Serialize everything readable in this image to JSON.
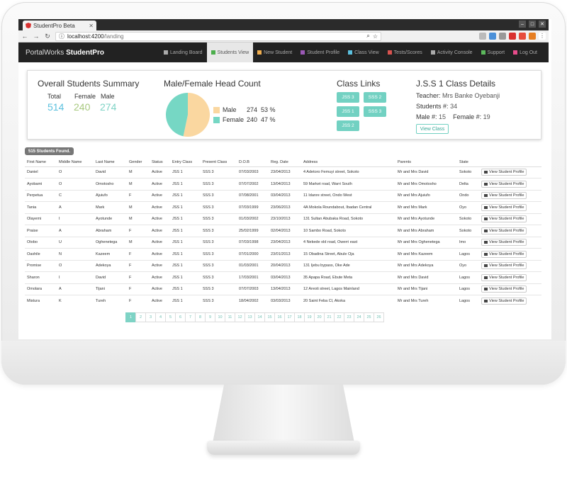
{
  "browser": {
    "tab_title": "StudentPro Beta",
    "url_host": "localhost:4200",
    "url_path": "/landing"
  },
  "navbar": {
    "brand_prefix": "PortalWorks",
    "brand_name": "StudentPro",
    "items": [
      {
        "label": "Landing Board",
        "icon": "home-icon",
        "color": "#aaaaaa"
      },
      {
        "label": "Students View",
        "icon": "eye-icon",
        "color": "#4cae4c"
      },
      {
        "label": "New Student",
        "icon": "user-icon",
        "color": "#f0ad4e"
      },
      {
        "label": "Student Profile",
        "icon": "profile-icon",
        "color": "#9b59b6"
      },
      {
        "label": "Class View",
        "icon": "users-icon",
        "color": "#5bc0de"
      },
      {
        "label": "Tests/Scores",
        "icon": "chart-icon",
        "color": "#d9534f"
      },
      {
        "label": "Activity Console",
        "icon": "image-icon",
        "color": "#aaaaaa"
      },
      {
        "label": "Support",
        "icon": "support-icon",
        "color": "#5cb85c"
      },
      {
        "label": "Log Out",
        "icon": "logout-icon",
        "color": "#e74c8b"
      }
    ]
  },
  "summary": {
    "title": "Overall Students Summary",
    "total_label": "Total",
    "female_label": "Female",
    "male_label": "Male",
    "total": "514",
    "female": "240",
    "male": "274"
  },
  "headcount": {
    "title": "Male/Female Head Count",
    "legend": [
      {
        "name": "Male",
        "count": "274",
        "pct": "53 %",
        "color": "#fad7a0"
      },
      {
        "name": "Female",
        "count": "240",
        "pct": "47 %",
        "color": "#76d7c4"
      }
    ]
  },
  "class_links": {
    "title": "Class Links",
    "items": [
      "JSS 3",
      "SSS 2",
      "JSS 1",
      "SSS 3",
      "JSS 2"
    ]
  },
  "class_details": {
    "title": "J.S.S 1 Class Details",
    "teacher_label": "Teacher:",
    "teacher": "Mrs Banke Oyebanji",
    "students_label": "Students #:",
    "students": "34",
    "male_label": "Male #:",
    "male": "15",
    "female_label": "Female #:",
    "female": "19",
    "button": "View Class"
  },
  "found_badge": "515 Students Found.",
  "table": {
    "headers": [
      "First Name",
      "Middle Name",
      "Last Name",
      "Gender",
      "Status",
      "Entry Class",
      "Present Class",
      "D.O.B",
      "Reg. Date",
      "Address",
      "Parents",
      "State",
      ""
    ],
    "action_label": "View Student Profile",
    "rows": [
      [
        "Daniel",
        "O",
        "David",
        "M",
        "Active",
        "JSS 1",
        "SSS 3",
        "07/03/2003",
        "23/04/2013",
        "4 Adetoro Femuyi street, Sokoto",
        "Mr and Mrs David",
        "Sokoto"
      ],
      [
        "Ayobami",
        "O",
        "Omotosho",
        "M",
        "Active",
        "JSS 1",
        "SSS 3",
        "07/07/2002",
        "13/04/2013",
        "59 Market road, Warri South",
        "Mr and Mrs Omotosho",
        "Delta"
      ],
      [
        "Perpetua",
        "C",
        "Ajuiufo",
        "F",
        "Active",
        "JSS 1",
        "SSS 3",
        "07/08/2001",
        "03/04/2013",
        "11 Idanre street, Ondo West",
        "Mr and Mrs Ajuiufo",
        "Ondo"
      ],
      [
        "Tania",
        "A",
        "Mark",
        "M",
        "Active",
        "JSS 1",
        "SSS 3",
        "07/03/1999",
        "23/06/2013",
        "4A Mokola Roundabout, Ibadan Central",
        "Mr and Mrs Mark",
        "Oyo"
      ],
      [
        "Olayemi",
        "I",
        "Ayotunde",
        "M",
        "Active",
        "JSS 1",
        "SSS 3",
        "01/03/2002",
        "23/10/2013",
        "131 Sultan Abubaka Road, Sokoto",
        "Mr and Mrs Ayotunde",
        "Sokoto"
      ],
      [
        "Praise",
        "A",
        "Abraham",
        "F",
        "Active",
        "JSS 1",
        "SSS 3",
        "25/02/1999",
        "02/04/2013",
        "10 Sambo Road, Sokoto",
        "Mr and Mrs Abraham",
        "Sokoto"
      ],
      [
        "Otobo",
        "U",
        "Oghenetega",
        "M",
        "Active",
        "JSS 1",
        "SSS 3",
        "07/03/1998",
        "23/04/2013",
        "4 Nekede old road, Owerri east",
        "Mr and Mrs Oghenetega",
        "Imo"
      ],
      [
        "Oashile",
        "N",
        "Kazeem",
        "F",
        "Active",
        "JSS 1",
        "SSS 3",
        "07/01/2000",
        "23/01/2013",
        "15 Obadina Street, Abule Oja",
        "Mr and Mrs Kazeem",
        "Lagos"
      ],
      [
        "Promise",
        "O",
        "Adekoya",
        "F",
        "Active",
        "JSS 1",
        "SSS 3",
        "01/03/2001",
        "20/04/2013",
        "131 Ijebu bypass, Oke Ade",
        "Mr and Mrs Adekoya",
        "Oyo"
      ],
      [
        "Sharon",
        "I",
        "David",
        "F",
        "Active",
        "JSS 1",
        "SSS 3",
        "17/03/2001",
        "03/04/2013",
        "35 Apapa Road, Ebute Meta",
        "Mr and Mrs David",
        "Lagos"
      ],
      [
        "Omolara",
        "A",
        "Tijani",
        "F",
        "Active",
        "JSS 1",
        "SSS 3",
        "07/07/2003",
        "13/04/2013",
        "12 Areoti street, Lagos Mainland",
        "Mr and Mrs Tijani",
        "Lagos"
      ],
      [
        "Mistura",
        "K",
        "Tureh",
        "F",
        "Active",
        "JSS 1",
        "SSS 3",
        "18/04/2002",
        "03/03/2013",
        "20 Saint Feba Cl, Akoka",
        "Mr and Mrs Tureh",
        "Lagos"
      ]
    ]
  },
  "pagination": {
    "pages": [
      "1",
      "2",
      "3",
      "4",
      "5",
      "6",
      "7",
      "8",
      "9",
      "10",
      "11",
      "12",
      "13",
      "14",
      "15",
      "16",
      "17",
      "18",
      "19",
      "20",
      "21",
      "22",
      "23",
      "24",
      "25",
      "26"
    ],
    "active": "1"
  },
  "colors": {
    "accent": "#72d1c2",
    "total_value": "#5bc0de",
    "female_value": "#a8c97f",
    "male_value": "#7ed3c5"
  }
}
